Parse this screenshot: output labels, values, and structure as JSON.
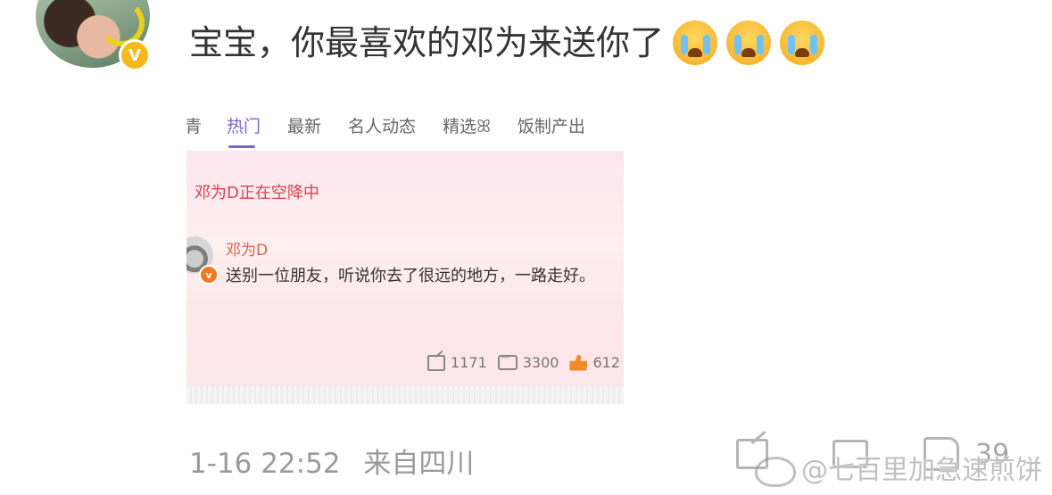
{
  "post": {
    "text": "宝宝，你最喜欢的邓为来送你了",
    "emojis": [
      "crying-face",
      "crying-face",
      "crying-face"
    ],
    "verified_badge": "V"
  },
  "screenshot": {
    "tabs": [
      "青",
      "热门",
      "最新",
      "名人动态",
      "精选⁠ꕤ",
      "饭制产出"
    ],
    "active_tab": "热门",
    "card_title": "邓为D正在空降中",
    "author": "邓为D",
    "body": "送别一位朋友，听说你去了很远的地方，一路走好。",
    "shares": "1171",
    "comments": "3300",
    "likes": "612"
  },
  "meta": {
    "timestamp": "1-16 22:52",
    "source": "来自四川",
    "like_count": "39"
  },
  "watermark": "@七百里加急速煎饼",
  "colors": {
    "active_tab": "#7a64c8",
    "card_title": "#d9434f",
    "badge": "#f6b81c"
  }
}
